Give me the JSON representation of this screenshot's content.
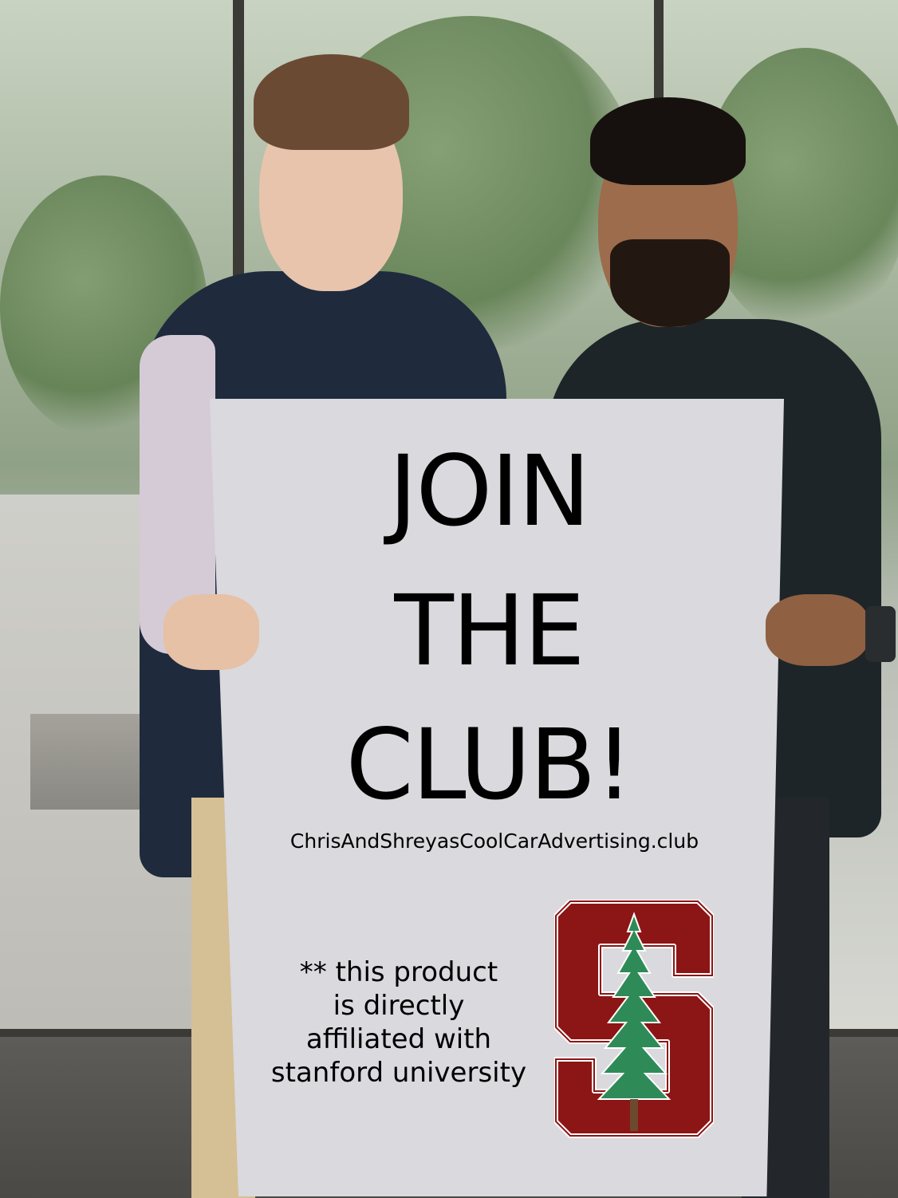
{
  "sign": {
    "title_lines": [
      "JOIN",
      "THE",
      "CLUB!"
    ],
    "url": "ChrisAndShreyasCoolCarAdvertising.club",
    "disclaimer_lines": [
      "** this product",
      "is  directly",
      "affiliated with",
      "stanford university"
    ]
  },
  "logo": {
    "icon": "stanford-s-tree-logo",
    "colors": {
      "cardinal": "#8c1515",
      "tree_green": "#2e8b57",
      "outline": "#ffffff"
    }
  },
  "scene": {
    "people": [
      "person-left",
      "person-right"
    ]
  }
}
